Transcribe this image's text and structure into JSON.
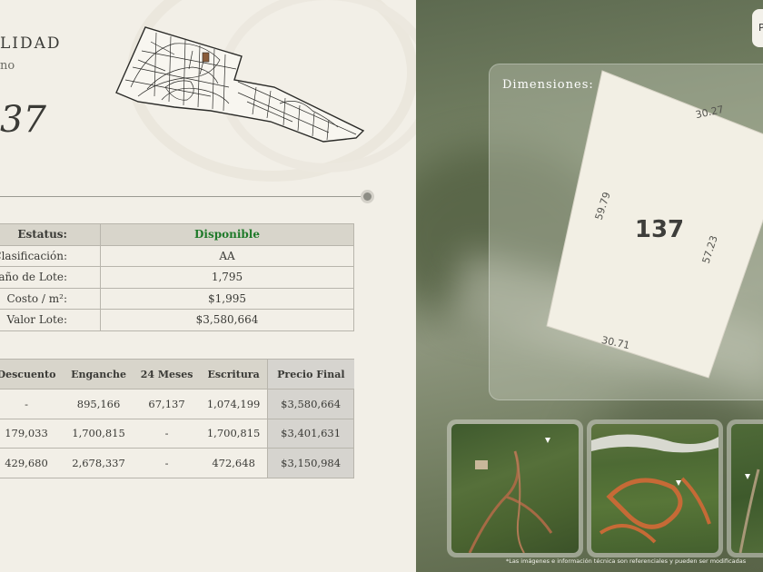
{
  "left": {
    "title": "LIDAD",
    "subtitle": "no",
    "lot_number": "37"
  },
  "info_table": [
    {
      "label": "Estatus:",
      "value": "Disponible"
    },
    {
      "label": "Clasificación:",
      "value": "AA"
    },
    {
      "label": "amaño de Lote:",
      "value": "1,795"
    },
    {
      "label": "Costo / m²:",
      "value": "$1,995"
    },
    {
      "label": "Valor Lote:",
      "value": "$3,580,664"
    }
  ],
  "payment_table": {
    "headers": [
      "Descuento",
      "Enganche",
      "24 Meses",
      "Escritura",
      "Precio Final"
    ],
    "rows": [
      [
        "-",
        "895,166",
        "67,137",
        "1,074,199",
        "$3,580,664"
      ],
      [
        "179,033",
        "1,700,815",
        "-",
        "1,700,815",
        "$3,401,631"
      ],
      [
        "429,680",
        "2,678,337",
        "-",
        "472,648",
        "$3,150,984"
      ]
    ]
  },
  "right": {
    "top_button": "P",
    "dimensions_label": "Dimensiones:",
    "lot_id": "137",
    "sides": {
      "top": "30.27",
      "left": "59.79",
      "right": "57.23",
      "bottom": "30.71"
    },
    "disclaimer": "*Las imágenes e información técnica son referenciales y pueden ser modificadas"
  },
  "colors": {
    "status_available": "#1f7a2a",
    "panel_bg": "#f2efe7",
    "table_header": "#d8d5cb"
  }
}
